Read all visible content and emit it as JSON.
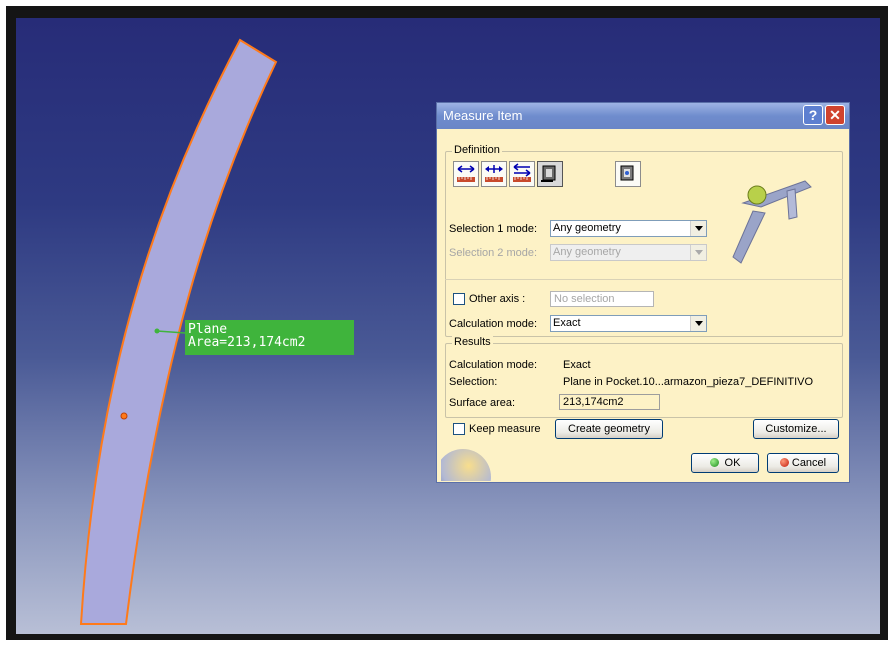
{
  "callout": {
    "line1": "Plane",
    "line2": "Area=213,174cm2"
  },
  "dialog": {
    "title": "Measure Item",
    "help_label": "?",
    "close_label": "✕",
    "definition": {
      "group_label": "Definition",
      "selection1_label": "Selection 1 mode:",
      "selection1_value": "Any geometry",
      "selection2_label": "Selection 2 mode:",
      "selection2_value": "Any geometry",
      "other_axis_label": "Other axis :",
      "other_axis_placeholder": "No selection",
      "calc_mode_label": "Calculation mode:",
      "calc_mode_value": "Exact"
    },
    "results": {
      "group_label": "Results",
      "calc_mode_label": "Calculation mode:",
      "calc_mode_value": "Exact",
      "selection_label": "Selection:",
      "selection_value": "Plane in Pocket.10...armazon_pieza7_DEFINITIVO",
      "surface_area_label": "Surface area:",
      "surface_area_value": "213,174cm2"
    },
    "keep_measure_label": "Keep measure",
    "create_geometry_label": "Create geometry",
    "customize_label": "Customize...",
    "ok_label": "OK",
    "cancel_label": "Cancel"
  },
  "colors": {
    "viewport_top": "#272c78",
    "part_fill": "#a9a9dc",
    "part_edge": "#ff7a1a",
    "callout_bg": "#3fb43c",
    "dialog_bg": "#fdf2c6",
    "titlebar": "#6f8ccd"
  },
  "icons": [
    "measure-between-icon",
    "measure-chain-icon",
    "measure-fan-icon",
    "measure-item-icon",
    "measure-inertia-icon",
    "caliper-icon",
    "ok-icon",
    "cancel-icon"
  ]
}
